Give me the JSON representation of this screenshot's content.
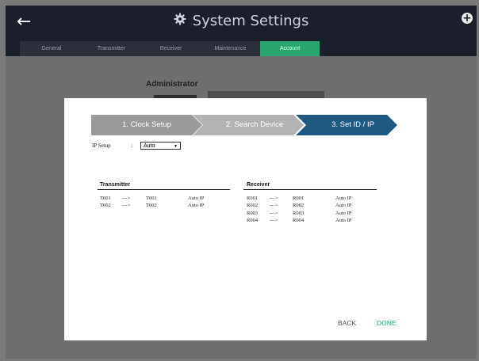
{
  "header": {
    "title": "System Settings"
  },
  "tabs": [
    {
      "label": "General"
    },
    {
      "label": "Transmitter"
    },
    {
      "label": "Receiver"
    },
    {
      "label": "Maintenance"
    },
    {
      "label": "Account"
    }
  ],
  "background": {
    "section_title": "Administrator"
  },
  "wizard": {
    "steps": [
      {
        "label": "1. Clock Setup"
      },
      {
        "label": "2. Search Device"
      },
      {
        "label": "3. Set ID / IP"
      }
    ],
    "ip_setup": {
      "label": "IP Setup",
      "colon": ":",
      "value": "Auto",
      "arrow": "▼"
    },
    "transmitter": {
      "title": "Transmitter",
      "rows": [
        {
          "from": "T001",
          "arrow": "--->",
          "to": "T001",
          "mode": "Auto IP"
        },
        {
          "from": "T002",
          "arrow": "--->",
          "to": "T002",
          "mode": "Auto IP"
        }
      ]
    },
    "receiver": {
      "title": "Receiver",
      "rows": [
        {
          "from": "R001",
          "arrow": "--->",
          "to": "R001",
          "mode": "Auto IP"
        },
        {
          "from": "R002",
          "arrow": "--->",
          "to": "R002",
          "mode": "Auto IP"
        },
        {
          "from": "R003",
          "arrow": "--->",
          "to": "R003",
          "mode": "Auto IP"
        },
        {
          "from": "R004",
          "arrow": "--->",
          "to": "R004",
          "mode": "Auto IP"
        }
      ]
    },
    "footer": {
      "back": "BACK",
      "done": "DONE"
    }
  },
  "colors": {
    "app_bg": "#1a1f2b",
    "active_tab": "#2aa56e",
    "step_inactive": "#9a9a9a",
    "step_done": "#b3b3b3",
    "step_active": "#1f5a85",
    "done_button": "#2aa56e"
  },
  "icons": {
    "back": "back-arrow-icon",
    "settings": "gear-icon",
    "add": "plus-icon",
    "dropdown": "chevron-down-icon"
  }
}
